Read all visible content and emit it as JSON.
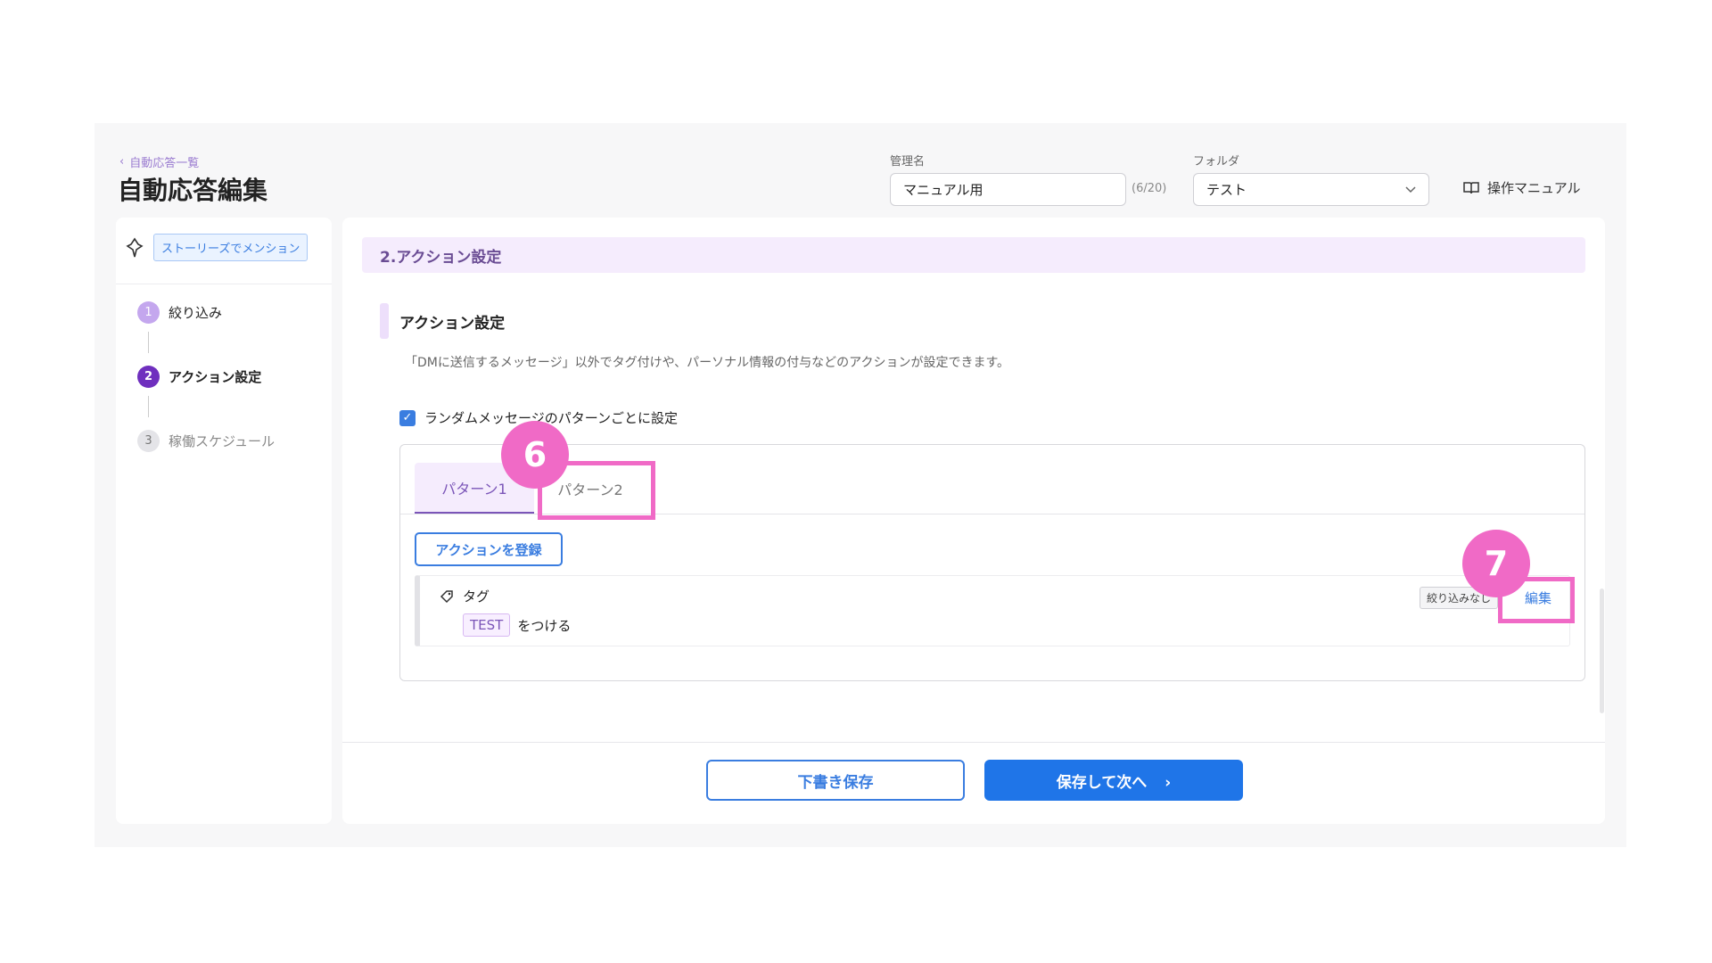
{
  "header": {
    "back_label": "自動応答一覧",
    "title": "自動応答編集",
    "name_label": "管理名",
    "name_value": "マニュアル用",
    "name_counter": "(6/20)",
    "folder_label": "フォルダ",
    "folder_value": "テスト",
    "manual_label": "操作マニュアル"
  },
  "sidebar": {
    "trigger_badge": "ストーリーズでメンション",
    "steps": [
      {
        "num": "1",
        "label": "絞り込み"
      },
      {
        "num": "2",
        "label": "アクション設定"
      },
      {
        "num": "3",
        "label": "稼働スケジュール"
      }
    ]
  },
  "main": {
    "section_title": "2.アクション設定",
    "sub_title": "アクション設定",
    "description": "「DMに送信するメッセージ」以外でタグ付けや、パーソナル情報の付与などのアクションが設定できます。",
    "checkbox_label": "ランダムメッセージのパターンごとに設定",
    "checkbox_checked": true,
    "tabs": [
      {
        "label": "パターン1"
      },
      {
        "label": "パターン2"
      }
    ],
    "register_button": "アクションを登録",
    "action": {
      "type_label": "タグ",
      "tag_name": "TEST",
      "suffix": "をつける",
      "filter_chip": "絞り込みなし",
      "edit_label": "編集"
    }
  },
  "footer": {
    "draft_button": "下書き保存",
    "next_button": "保存して次へ"
  },
  "annotations": {
    "marker_6": "6",
    "marker_7": "7"
  },
  "colors": {
    "accent_blue": "#1f75e8",
    "purple": "#7b55b8",
    "highlight_pink": "#f06ac6"
  }
}
